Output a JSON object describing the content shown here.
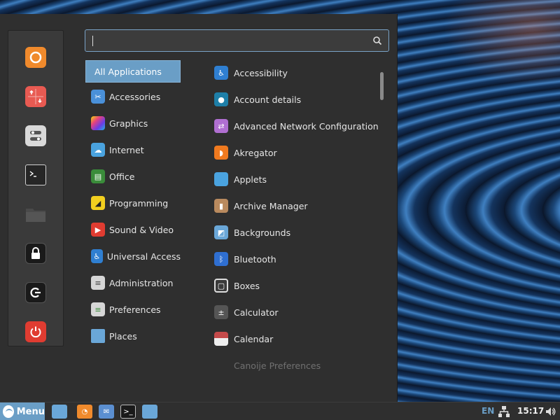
{
  "search": {
    "placeholder": ""
  },
  "favorites": [
    {
      "name": "firefox-icon",
      "color": "#e87722"
    },
    {
      "name": "software-manager-icon",
      "color": "#d9534f"
    },
    {
      "name": "settings-toggle-icon",
      "color": "#d6d6d6"
    },
    {
      "name": "terminal-icon",
      "color": "#2a2a2a"
    },
    {
      "name": "files-icon",
      "color": "#4a4a4a"
    },
    {
      "name": "lock-screen-icon",
      "color": "#1e1e1e"
    },
    {
      "name": "logout-icon",
      "color": "#1e1e1e"
    },
    {
      "name": "power-icon",
      "color": "#e03c31"
    }
  ],
  "categories": [
    {
      "label": "All Applications",
      "selected": true
    },
    {
      "label": "Accessories",
      "icon": "scissors-icon",
      "color": "#4a90d9"
    },
    {
      "label": "Graphics",
      "icon": "palette-icon",
      "color": "#9b59b6"
    },
    {
      "label": "Internet",
      "icon": "cloud-icon",
      "color": "#4aa3df"
    },
    {
      "label": "Office",
      "icon": "document-icon",
      "color": "#3a8c3a"
    },
    {
      "label": "Programming",
      "icon": "code-icon",
      "color": "#e6c229"
    },
    {
      "label": "Sound & Video",
      "icon": "play-icon",
      "color": "#e03c31"
    },
    {
      "label": "Universal Access",
      "icon": "accessibility-icon",
      "color": "#2f7fd1"
    },
    {
      "label": "Administration",
      "icon": "toggle-icon",
      "color": "#d6d6d6"
    },
    {
      "label": "Preferences",
      "icon": "toggle-green-icon",
      "color": "#d6d6d6"
    },
    {
      "label": "Places",
      "icon": "folder-icon",
      "color": "#6aa7d8"
    }
  ],
  "apps": [
    {
      "label": "Accessibility",
      "icon": "accessibility-icon",
      "color": "#2f7fd1"
    },
    {
      "label": "Account details",
      "icon": "user-icon",
      "color": "#1e7fa8"
    },
    {
      "label": "Advanced Network Configuration",
      "icon": "network-icon",
      "color": "#b06fd1"
    },
    {
      "label": "Akregator",
      "icon": "rss-icon",
      "color": "#f07a1f"
    },
    {
      "label": "Applets",
      "icon": "applets-icon",
      "color": "#4aa3df"
    },
    {
      "label": "Archive Manager",
      "icon": "archive-icon",
      "color": "#b98a5e"
    },
    {
      "label": "Backgrounds",
      "icon": "image-icon",
      "color": "#6aa7d8"
    },
    {
      "label": "Bluetooth",
      "icon": "bluetooth-icon",
      "color": "#2f6fd1"
    },
    {
      "label": "Boxes",
      "icon": "boxes-icon",
      "color": "#3a3a3a"
    },
    {
      "label": "Calculator",
      "icon": "calculator-icon",
      "color": "#555555"
    },
    {
      "label": "Calendar",
      "icon": "calendar-icon",
      "color": "#c44a4a"
    },
    {
      "label": "Canoije Preferences",
      "icon": "blank-icon",
      "color": "#555555",
      "faded": true
    }
  ],
  "taskbar": {
    "menu_label": "Menu",
    "language": "EN",
    "clock": "15:17"
  }
}
